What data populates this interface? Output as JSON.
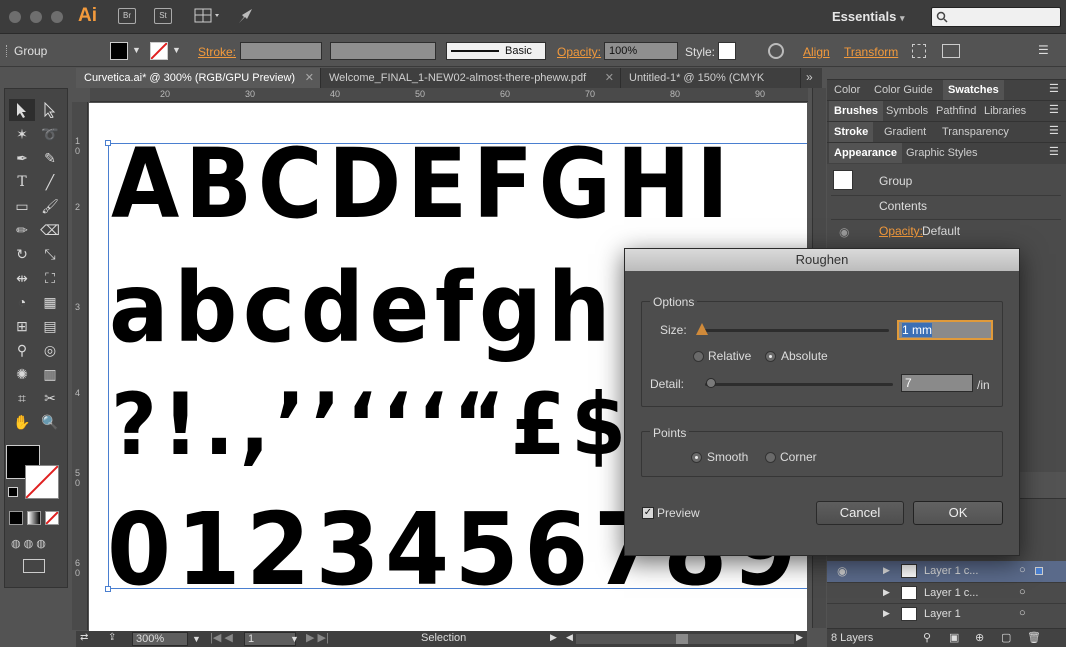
{
  "app": {
    "logo": "Ai",
    "icons": [
      "Br",
      "St"
    ],
    "workspace": "Essentials",
    "workspace_arrow": "▾"
  },
  "control_bar": {
    "selection_type": "Group",
    "stroke_label": "Stroke:",
    "brush_label": "Basic",
    "opacity_label": "Opacity:",
    "opacity_value": "100%",
    "style_label": "Style:",
    "align_label": "Align",
    "transform_label": "Transform"
  },
  "tabs": [
    "Curvetica.ai* @ 300% (RGB/GPU Preview)",
    "Welcome_FINAL_1-NEW02-almost-there-pheww.pdf",
    "Untitled-1* @ 150% (CMYK"
  ],
  "ruler_h": [
    "20",
    "30",
    "40",
    "50",
    "60",
    "70",
    "80",
    "90"
  ],
  "ruler_v": [
    "1 0",
    "2",
    "3",
    "4",
    "5 0",
    "6 0"
  ],
  "canvas": {
    "row1": "ABCDEFGHI",
    "row2": "abcdefgh",
    "row3": "?!.,’’‘‘‘“£$",
    "row4": "0123456789"
  },
  "status": {
    "zoom": "300%",
    "artboard": "1",
    "tool": "Selection"
  },
  "panels": {
    "group1": [
      "Color",
      "Color Guide",
      "Swatches"
    ],
    "group2": [
      "Brushes",
      "Symbols",
      "Pathfind",
      "Libraries"
    ],
    "group3": [
      "Stroke",
      "Gradient",
      "Transparency"
    ],
    "group4": [
      "Appearance",
      "Graphic Styles"
    ],
    "appearance": {
      "item": "Group",
      "contents": "Contents",
      "opacity_label": "Opacity:",
      "opacity_value": "Default"
    },
    "layers": [
      "Layer 1 c...",
      "Layer 1 c...",
      "Layer 1"
    ],
    "layers_count": "8 Layers"
  },
  "dialog": {
    "title": "Roughen",
    "options_label": "Options",
    "size_label": "Size:",
    "size_value": "1 mm",
    "relative_label": "Relative",
    "absolute_label": "Absolute",
    "detail_label": "Detail:",
    "detail_value": "7",
    "detail_unit": "/in",
    "points_label": "Points",
    "smooth_label": "Smooth",
    "corner_label": "Corner",
    "preview_label": "Preview",
    "cancel_label": "Cancel",
    "ok_label": "OK"
  }
}
